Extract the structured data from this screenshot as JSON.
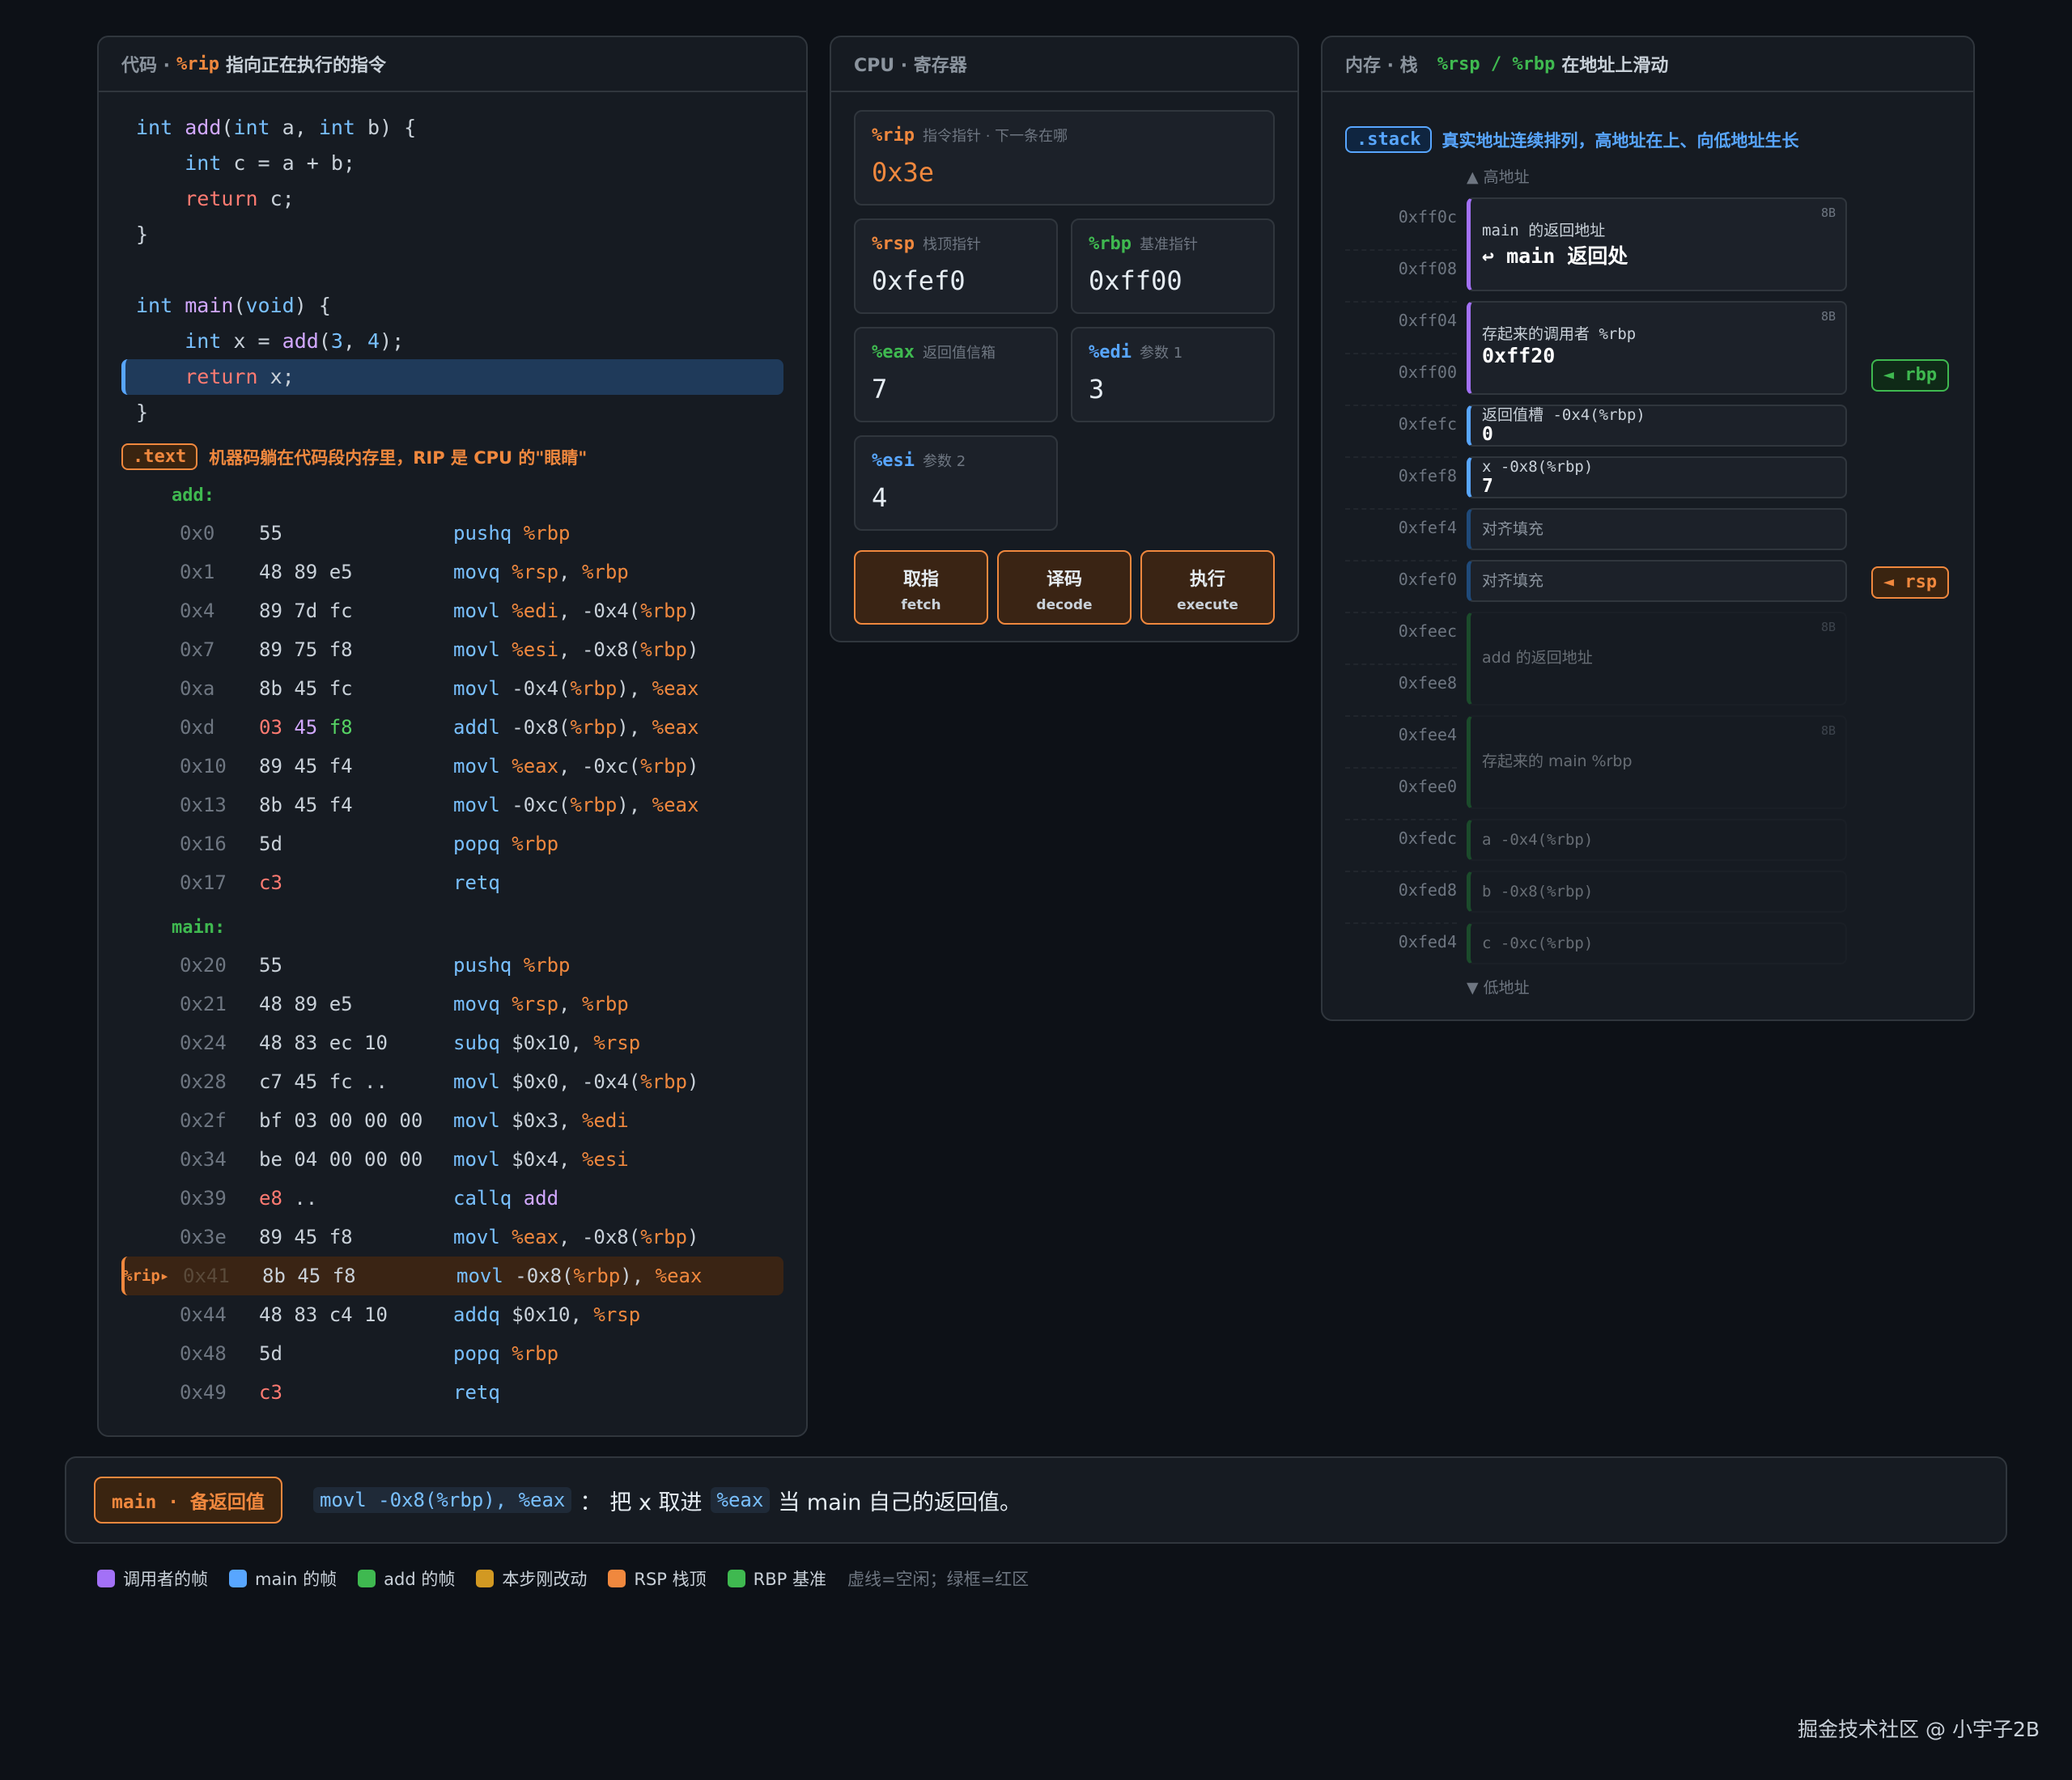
{
  "code": {
    "head": {
      "prefix": "代码 ·",
      "reg": "%rip",
      "suffix": "指向正在执行的指令"
    },
    "source": [
      "int add(int a, int b) {",
      "    int c = a + b;",
      "    return c;",
      "}",
      "",
      "int main(void) {",
      "    int x = add(3, 4);",
      "    return x;",
      "}"
    ],
    "text_tag": ".text",
    "text_desc": "机器码躺在代码段内存里，RIP 是 CPU 的\"眼睛\"",
    "add_label": "add:",
    "main_label": "main:",
    "rip_marker": "%rip",
    "add_rows": [
      {
        "addr": "0x0",
        "bytes": "55",
        "op": "pushq",
        "args": "%rbp"
      },
      {
        "addr": "0x1",
        "bytes": "48 89 e5",
        "op": "movq",
        "args": "%rsp, %rbp"
      },
      {
        "addr": "0x4",
        "bytes": "89 7d fc",
        "op": "movl",
        "args": "%edi, -0x4(%rbp)"
      },
      {
        "addr": "0x7",
        "bytes": "89 75 f8",
        "op": "movl",
        "args": "%esi, -0x8(%rbp)"
      },
      {
        "addr": "0xa",
        "bytes": "8b 45 fc",
        "op": "movl",
        "args": "-0x4(%rbp), %eax"
      },
      {
        "addr": "0xd",
        "bytes": "03 45 f8",
        "op": "addl",
        "args": "-0x8(%rbp), %eax"
      },
      {
        "addr": "0x10",
        "bytes": "89 45 f4",
        "op": "movl",
        "args": "%eax, -0xc(%rbp)"
      },
      {
        "addr": "0x13",
        "bytes": "8b 45 f4",
        "op": "movl",
        "args": "-0xc(%rbp), %eax"
      },
      {
        "addr": "0x16",
        "bytes": "5d",
        "op": "popq",
        "args": "%rbp"
      },
      {
        "addr": "0x17",
        "bytes": "c3",
        "op": "retq",
        "args": ""
      }
    ],
    "main_rows": [
      {
        "addr": "0x20",
        "bytes": "55",
        "op": "pushq",
        "args": "%rbp"
      },
      {
        "addr": "0x21",
        "bytes": "48 89 e5",
        "op": "movq",
        "args": "%rsp, %rbp"
      },
      {
        "addr": "0x24",
        "bytes": "48 83 ec 10",
        "op": "subq",
        "args": "$0x10, %rsp"
      },
      {
        "addr": "0x28",
        "bytes": "c7 45 fc ..",
        "op": "movl",
        "args": "$0x0, -0x4(%rbp)"
      },
      {
        "addr": "0x2f",
        "bytes": "bf 03 00 00 00",
        "op": "movl",
        "args": "$0x3, %edi"
      },
      {
        "addr": "0x34",
        "bytes": "be 04 00 00 00",
        "op": "movl",
        "args": "$0x4, %esi"
      },
      {
        "addr": "0x39",
        "bytes": "e8 ..",
        "op": "callq",
        "args": "add"
      },
      {
        "addr": "0x3e",
        "bytes": "89 45 f8",
        "op": "movl",
        "args": "%eax, -0x8(%rbp)"
      },
      {
        "addr": "0x41",
        "bytes": "8b 45 f8",
        "op": "movl",
        "args": "-0x8(%rbp), %eax"
      },
      {
        "addr": "0x44",
        "bytes": "48 83 c4 10",
        "op": "addq",
        "args": "$0x10, %rsp"
      },
      {
        "addr": "0x48",
        "bytes": "5d",
        "op": "popq",
        "args": "%rbp"
      },
      {
        "addr": "0x49",
        "bytes": "c3",
        "op": "retq",
        "args": ""
      }
    ]
  },
  "cpu": {
    "head": "CPU · 寄存器",
    "rip": {
      "name": "%rip",
      "desc": "指令指针 · 下一条在哪",
      "value": "0x3e"
    },
    "rsp": {
      "name": "%rsp",
      "desc": "栈顶指针",
      "value": "0xfef0"
    },
    "rbp": {
      "name": "%rbp",
      "desc": "基准指针",
      "value": "0xff00"
    },
    "eax": {
      "name": "%eax",
      "desc": "返回值信箱",
      "value": "7"
    },
    "edi": {
      "name": "%edi",
      "desc": "参数 1",
      "value": "3"
    },
    "esi": {
      "name": "%esi",
      "desc": "参数 2",
      "value": "4"
    },
    "buttons": [
      {
        "label": "取指",
        "sub": "fetch"
      },
      {
        "label": "译码",
        "sub": "decode"
      },
      {
        "label": "执行",
        "sub": "execute"
      }
    ]
  },
  "memory": {
    "head": {
      "prefix": "内存 · 栈",
      "regs": "%rsp / %rbp",
      "suffix": "在地址上滑动"
    },
    "stack_tag": ".stack",
    "stack_desc": "真实地址连续排列，高地址在上、向低地址生长",
    "high_label": "▲ 高地址",
    "low_label": "▼ 低地址",
    "addresses": [
      "0xff0c",
      "0xff08",
      "0xff04",
      "0xff00",
      "0xfefc",
      "0xfef8",
      "0xfef4",
      "0xfef0",
      "0xfeec",
      "0xfee8",
      "0xfee4",
      "0xfee0",
      "0xfedc",
      "0xfed8",
      "0xfed4"
    ],
    "slots": {
      "ret_main": {
        "label": "main 的返回地址",
        "value": "↩ main 返回处",
        "size": "8B"
      },
      "saved_rbp": {
        "label": "存起来的调用者 %rbp",
        "value": "0xff20",
        "size": "8B"
      },
      "ret_slot": {
        "label": "返回值槽 -0x4(%rbp)",
        "value": "0"
      },
      "x_slot": {
        "label": "x -0x8(%rbp)",
        "value": "7"
      },
      "pad1": {
        "label": "对齐填充"
      },
      "pad2": {
        "label": "对齐填充"
      },
      "ret_add": {
        "label": "add 的返回地址",
        "size": "8B"
      },
      "saved_main_rbp": {
        "label": "存起来的 main %rbp",
        "size": "8B"
      },
      "a_slot": {
        "label": "a -0x4(%rbp)"
      },
      "b_slot": {
        "label": "b -0x8(%rbp)"
      },
      "c_slot": {
        "label": "c -0xc(%rbp)"
      }
    },
    "rbp_ptr": "◄ rbp",
    "rsp_ptr": "◄ rsp"
  },
  "status": {
    "chip": "main · 备返回值",
    "code": "movl -0x8(%rbp), %eax",
    "sep": "：",
    "text1": "把 x 取进",
    "reg": "%eax",
    "text2": "当 main 自己的返回值。"
  },
  "legend": {
    "items": [
      {
        "label": "调用者的帧",
        "color": "#a371f7"
      },
      {
        "label": "main 的帧",
        "color": "#58a6ff"
      },
      {
        "label": "add 的帧",
        "color": "#3fb950"
      },
      {
        "label": "本步刚改动",
        "color": "#d29922"
      },
      {
        "label": "RSP 栈顶",
        "color": "#f0883e"
      },
      {
        "label": "RBP 基准",
        "color": "#3fb950"
      }
    ],
    "note": "虚线=空闲；绿框=红区"
  },
  "watermark": "掘金技术社区 @ 小宇子2B"
}
